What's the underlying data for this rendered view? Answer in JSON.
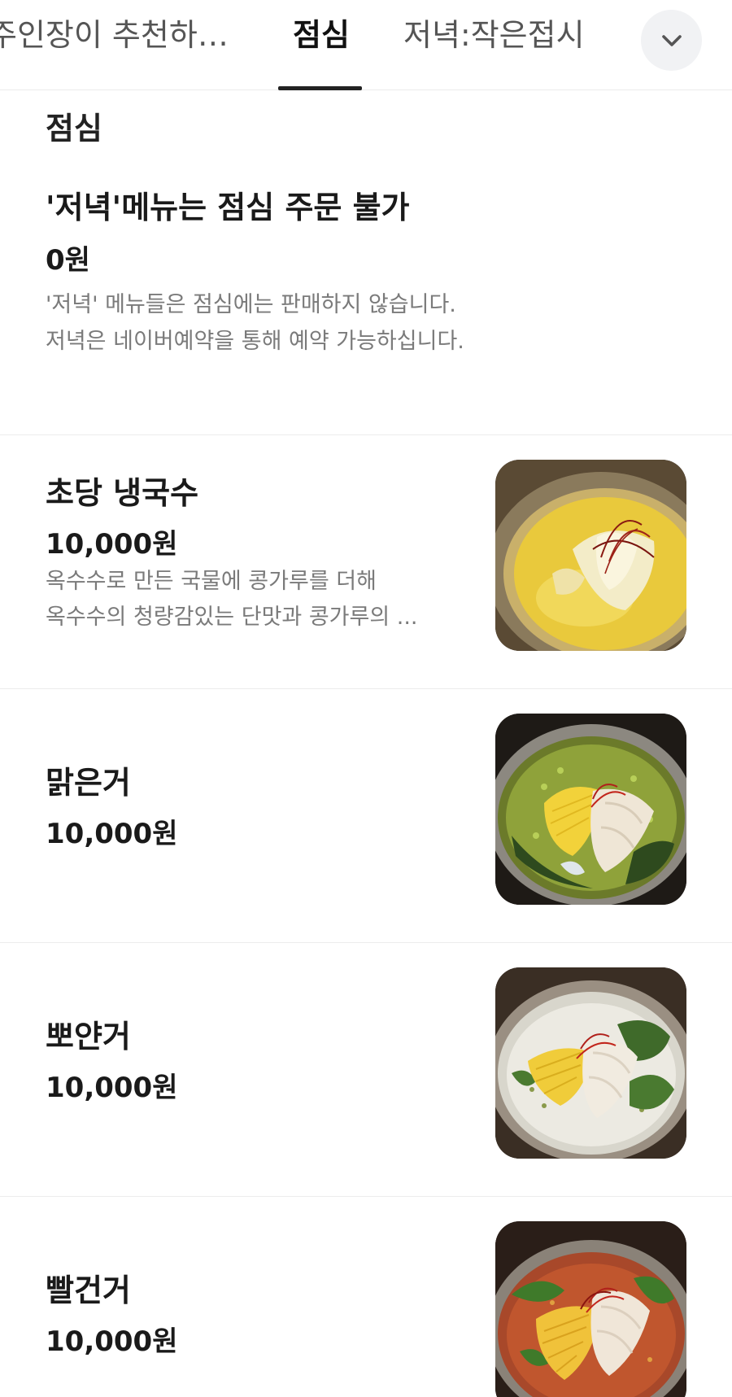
{
  "tabs": [
    {
      "label": "주인장이 추천하는 ...",
      "active": false
    },
    {
      "label": "점심",
      "active": true
    },
    {
      "label": "저녁:작은접시",
      "active": false
    }
  ],
  "tab_more_icon": "chevron-down-icon",
  "section": {
    "title": "점심",
    "notice": {
      "name": "'저녁'메뉴는 점심 주문 불가",
      "price": "0원",
      "description": [
        "'저녁' 메뉴들은 점심에는 판매하지 않습니다.",
        "저녁은 네이버예약을 통해 예약 가능하십니다."
      ]
    },
    "items": [
      {
        "name": "초당 냉국수",
        "price": "10,000원",
        "description": [
          "옥수수로 만든 국물에 콩가루를 더해",
          "옥수수의 청량감있는 단맛과 콩가루의 ..."
        ],
        "image": "corn-noodle-soup-photo"
      },
      {
        "name": "맑은거",
        "price": "10,000원",
        "image": "clear-noodle-soup-photo"
      },
      {
        "name": "뽀얀거",
        "price": "10,000원",
        "image": "milky-noodle-soup-photo"
      },
      {
        "name": "빨건거",
        "price": "10,000원",
        "image": "red-noodle-soup-photo"
      }
    ]
  },
  "colors": {
    "text_primary": "#1a1a1a",
    "text_secondary": "#7a7a7a",
    "divider": "#ececec",
    "active_tab_indicator": "#222222",
    "more_button_bg": "#f1f2f4"
  }
}
